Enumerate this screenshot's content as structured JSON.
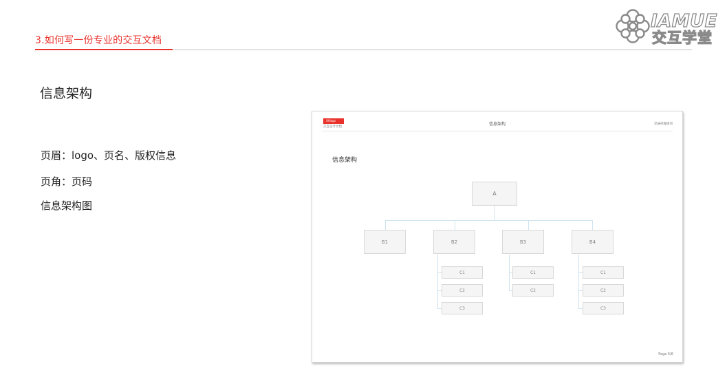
{
  "header": {
    "section_title": "3.如何写一份专业的交互文档"
  },
  "brand": {
    "latin": "IAMUE",
    "chinese": "交互学堂",
    "icon": "flower-logo-icon"
  },
  "main": {
    "heading": "信息架构",
    "bullets": [
      "页眉：logo、页名、版权信息",
      "页角：页码",
      "信息架构图"
    ]
  },
  "preview": {
    "logo_text": "UI/logo",
    "logo_sub": "交互设计文档",
    "page_title": "信息架构",
    "copyright": "交床内容提司",
    "heading": "信息架构",
    "page_number": "Page 5/6",
    "tree": {
      "root": "A",
      "b": [
        "B1",
        "B2",
        "B3",
        "B4"
      ],
      "c_b2": [
        "C1",
        "C2",
        "C3"
      ],
      "c_b3": [
        "C1",
        "C2"
      ],
      "c_b4": [
        "C1",
        "C2",
        "C3"
      ]
    }
  },
  "colors": {
    "accent": "#e8322b",
    "connector": "#cfe4ef"
  }
}
